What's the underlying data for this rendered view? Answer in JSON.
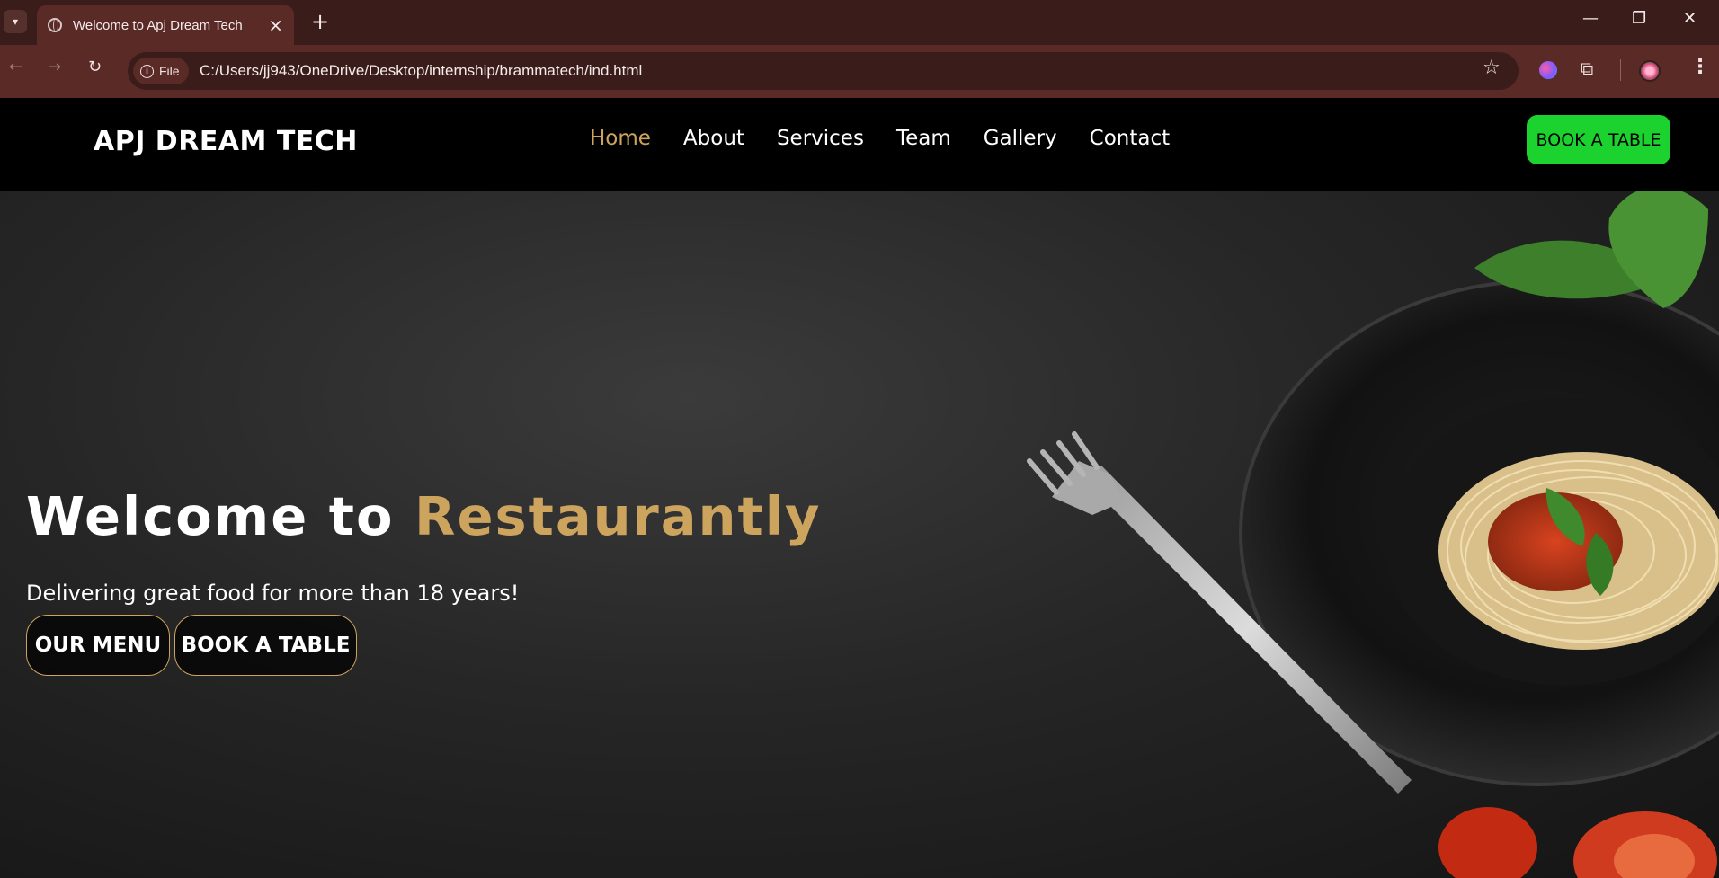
{
  "browser": {
    "tab_title": "Welcome to Apj Dream Tech",
    "url_scheme": "File",
    "url": "C:/Users/jj943/OneDrive/Desktop/internship/brammatech/ind.html"
  },
  "site": {
    "logo": "APJ DREAM TECH",
    "nav": {
      "home": "Home",
      "about": "About",
      "services": "Services",
      "team": "Team",
      "gallery": "Gallery",
      "contact": "Contact"
    },
    "book_button": "BOOK A TABLE"
  },
  "hero": {
    "title_prefix": "Welcome to ",
    "title_accent": "Restaurantly",
    "subtitle": "Delivering great food for more than 18 years!",
    "menu_button": "OUR MENU",
    "book_button": "BOOK A TABLE"
  },
  "colors": {
    "accent": "#cda45e",
    "book_green": "#1bd22f",
    "browser_frame": "#3a1c1a"
  }
}
